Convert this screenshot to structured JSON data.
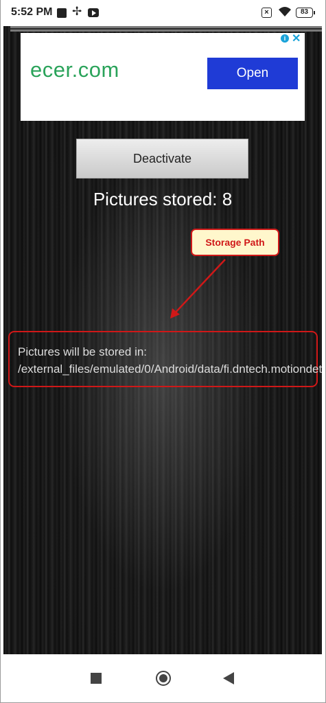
{
  "status_bar": {
    "time": "5:52 PM",
    "battery": "83",
    "icons": [
      "square-notification-icon",
      "fan-icon",
      "youtube-icon",
      "close-box-icon",
      "wifi-icon",
      "battery-icon"
    ]
  },
  "ad": {
    "logo_text": "ecer.com",
    "button_label": "Open",
    "info_glyph": "i",
    "close_glyph": "✕"
  },
  "main": {
    "deactivate_label": "Deactivate",
    "pictures_stored": "Pictures stored: 8",
    "callout_label": "Storage Path",
    "storage_path_text": "Pictures will be stored in: /external_files/emulated/0/Android/data/fi.dntech.motiondetector/files"
  },
  "colors": {
    "annotation_red": "#d01818",
    "ad_button_blue": "#1f3bd6",
    "ad_logo_green": "#2aa35a"
  }
}
